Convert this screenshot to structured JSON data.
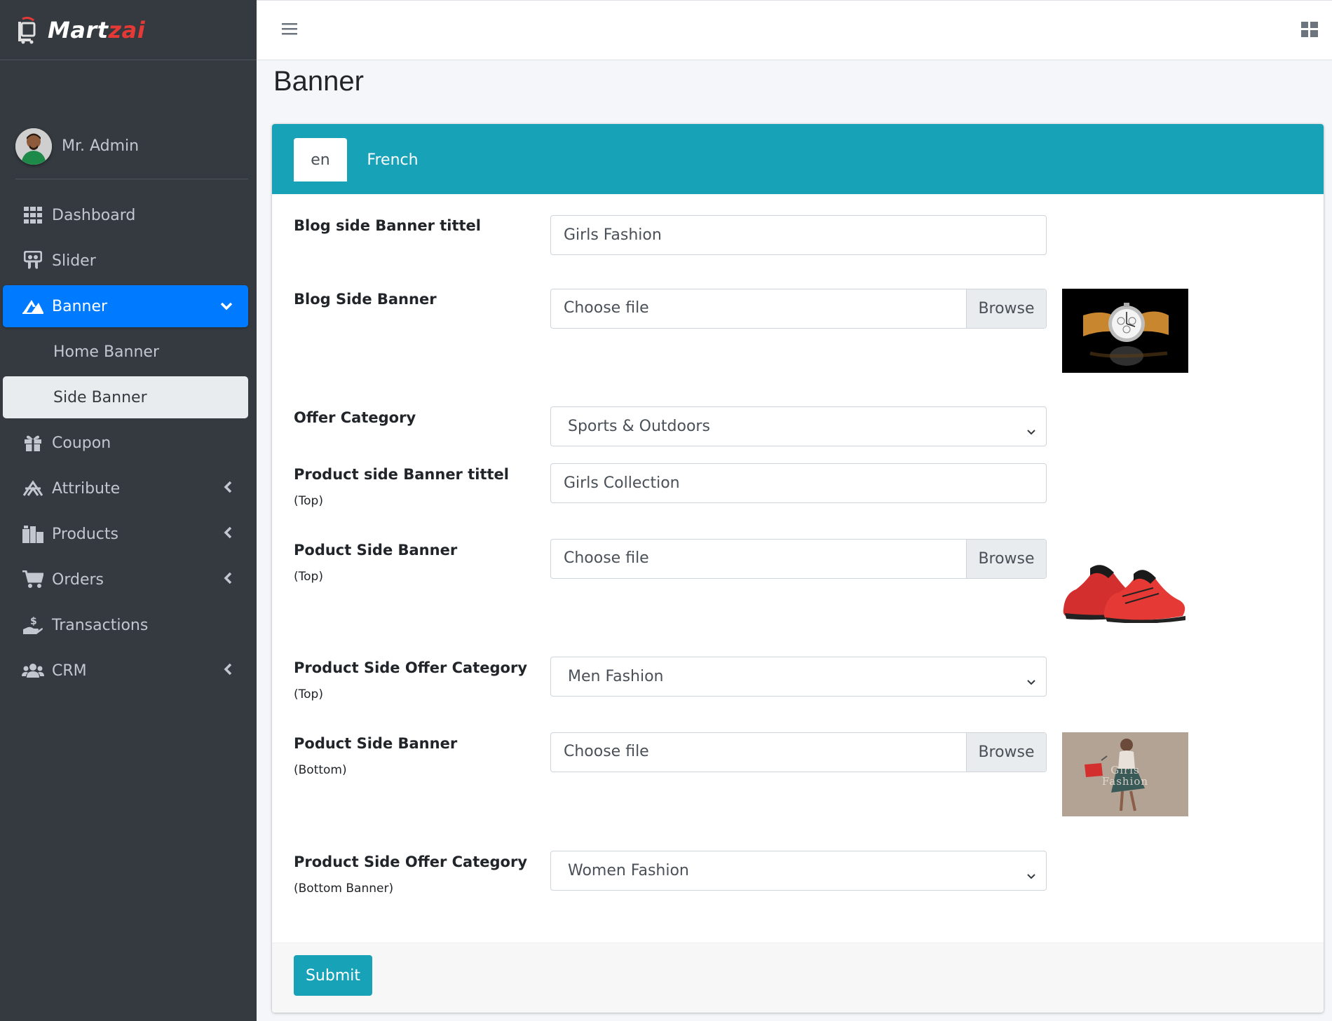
{
  "brand": {
    "part1": "Mart",
    "part2": "zai"
  },
  "user": {
    "name": "Mr. Admin"
  },
  "nav": {
    "dashboard": "Dashboard",
    "slider": "Slider",
    "banner": "Banner",
    "home_banner": "Home Banner",
    "side_banner": "Side Banner",
    "coupon": "Coupon",
    "attribute": "Attribute",
    "products": "Products",
    "orders": "Orders",
    "transactions": "Transactions",
    "crm": "CRM"
  },
  "page": {
    "title": "Banner"
  },
  "tabs": {
    "en": "en",
    "french": "French"
  },
  "form": {
    "blog_title_label": "Blog side Banner tittel",
    "blog_title_value": "Girls Fashion",
    "blog_banner_label": "Blog Side Banner",
    "file_placeholder": "Choose file",
    "browse_label": "Browse",
    "offer_category_label": "Offer Category",
    "offer_category_value": "Sports & Outdoors",
    "product_title_label": "Product side Banner tittel",
    "top_note": "(Top)",
    "product_title_value": "Girls Collection",
    "poduct_banner_label": "Poduct Side Banner",
    "product_offer_label": "Product Side Offer Category",
    "product_offer_top_value": "Men Fashion",
    "bottom_note": "(Bottom)",
    "bottom_banner_note": "(Bottom Banner)",
    "product_offer_bottom_value": "Women Fashion",
    "thumb3_text": "Girls Fashion",
    "submit_label": "Submit"
  },
  "colors": {
    "sidebar": "#343a40",
    "active": "#007bff",
    "header": "#17a2b8",
    "brand_accent": "#e53935"
  }
}
